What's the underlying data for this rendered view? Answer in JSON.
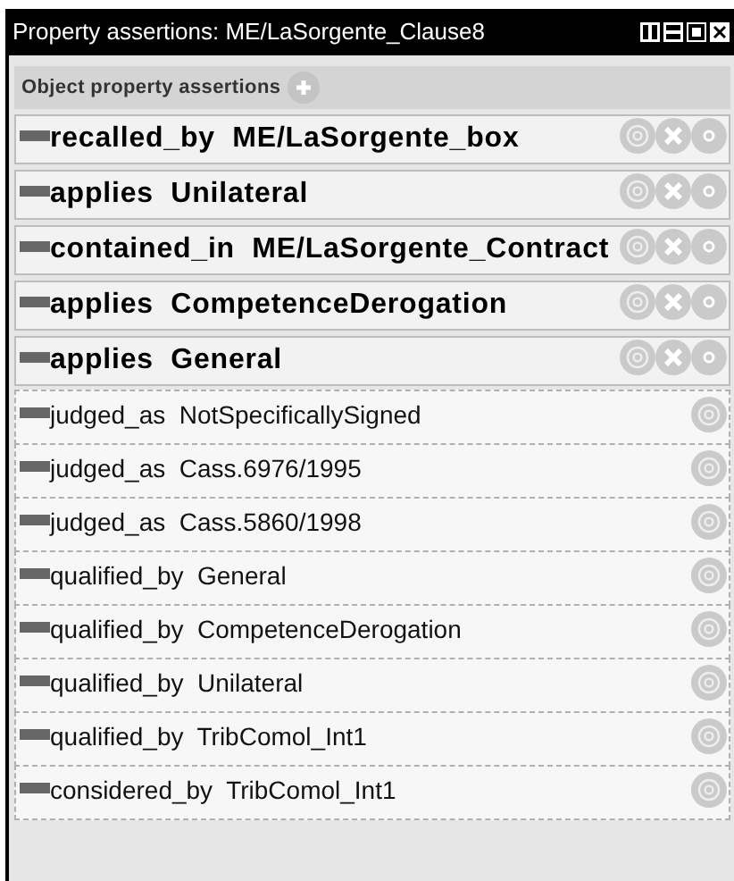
{
  "window": {
    "title": "Property assertions: ME/LaSorgente_Clause8"
  },
  "section": {
    "title": "Object property assertions"
  },
  "assertions": [
    {
      "kind": "asserted",
      "text": "recalled_by  ME/LaSorgente_box"
    },
    {
      "kind": "asserted",
      "text": "applies  Unilateral"
    },
    {
      "kind": "asserted",
      "text": "contained_in  ME/LaSorgente_Contract"
    },
    {
      "kind": "asserted",
      "text": "applies  CompetenceDerogation"
    },
    {
      "kind": "asserted",
      "text": "applies  General"
    },
    {
      "kind": "inferred",
      "text": "judged_as  NotSpecificallySigned"
    },
    {
      "kind": "inferred",
      "text": "judged_as  Cass.6976/1995"
    },
    {
      "kind": "inferred",
      "text": "judged_as  Cass.5860/1998"
    },
    {
      "kind": "inferred",
      "text": "qualified_by  General"
    },
    {
      "kind": "inferred",
      "text": "qualified_by  CompetenceDerogation"
    },
    {
      "kind": "inferred",
      "text": "qualified_by  Unilateral"
    },
    {
      "kind": "inferred",
      "text": "qualified_by  TribComol_Int1"
    },
    {
      "kind": "inferred",
      "text": "considered_by  TribComol_Int1"
    }
  ]
}
